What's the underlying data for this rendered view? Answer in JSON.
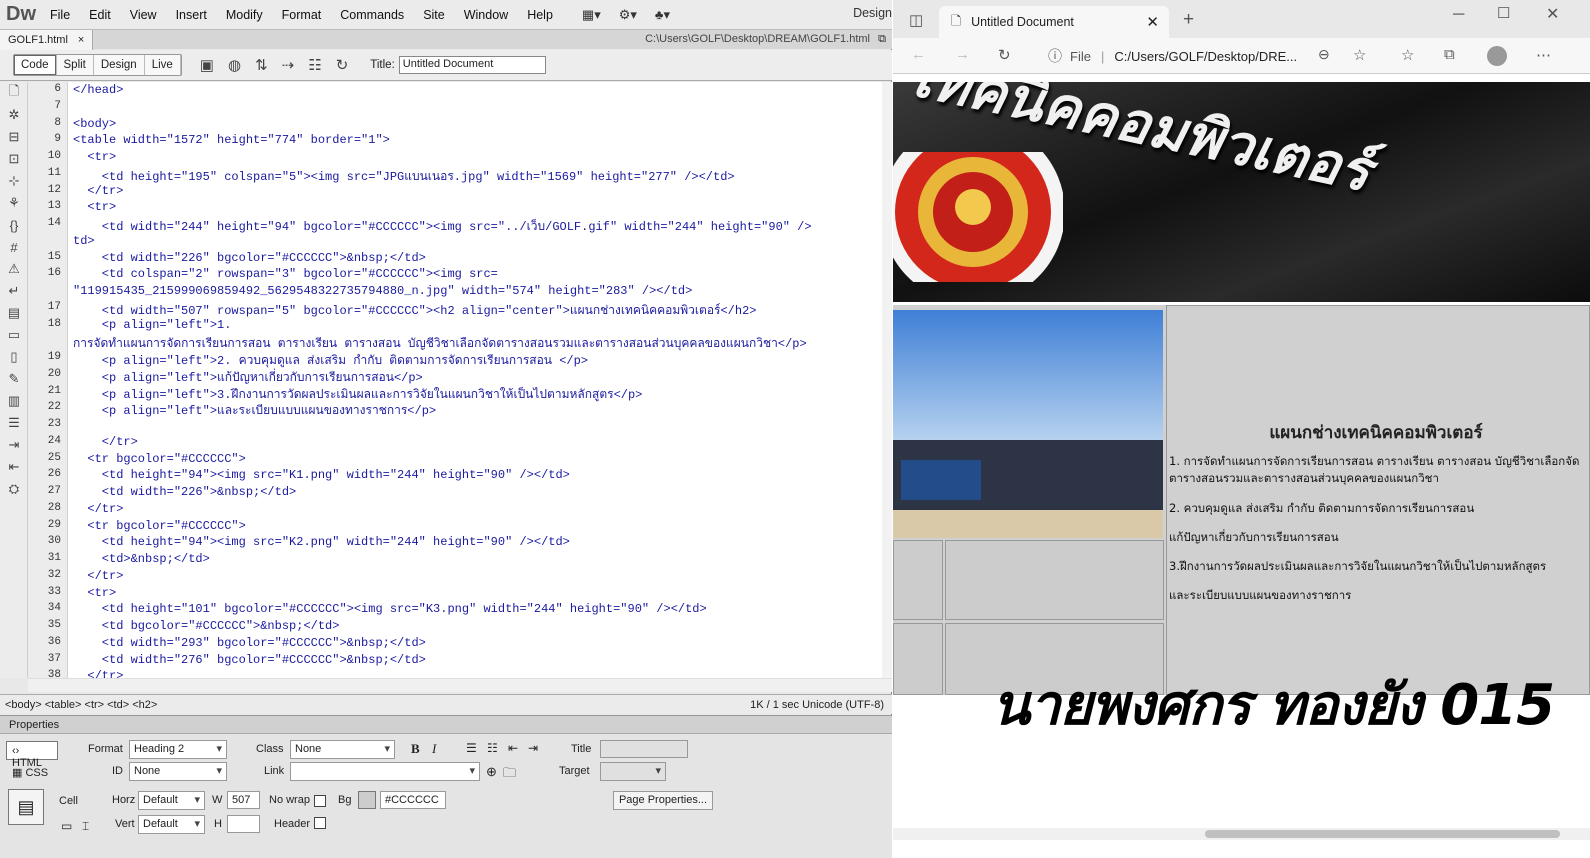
{
  "menubar": {
    "logo": "Dw",
    "items": [
      "File",
      "Edit",
      "View",
      "Insert",
      "Modify",
      "Format",
      "Commands",
      "Site",
      "Window",
      "Help"
    ],
    "workspace": "Design"
  },
  "docbar": {
    "tab": "GOLF1.html",
    "path": "C:\\Users\\GOLF\\Desktop\\DREAM\\GOLF1.html"
  },
  "toolbar": {
    "code": "Code",
    "split": "Split",
    "design": "Design",
    "live": "Live",
    "title_label": "Title:",
    "title_value": "Untitled Document"
  },
  "code": {
    "lines": [
      {
        "n": "6",
        "t": "</head>"
      },
      {
        "n": "7",
        "t": ""
      },
      {
        "n": "8",
        "t": "<body>"
      },
      {
        "n": "9",
        "t": "<table width=\"1572\" height=\"774\" border=\"1\">"
      },
      {
        "n": "10",
        "t": "  <tr>"
      },
      {
        "n": "11",
        "t": "    <td height=\"195\" colspan=\"5\"><img src=\"JPGแบนเนอร.jpg\" width=\"1569\" height=\"277\" /></td>"
      },
      {
        "n": "12",
        "t": "  </tr>"
      },
      {
        "n": "13",
        "t": "  <tr>"
      },
      {
        "n": "14",
        "t": "    <td width=\"244\" height=\"94\" bgcolor=\"#CCCCCC\"><img src=\"../เว็บ/GOLF.gif\" width=\"244\" height=\"90\" />"
      },
      {
        "n": "",
        "t": "td>"
      },
      {
        "n": "15",
        "t": "    <td width=\"226\" bgcolor=\"#CCCCCC\">&nbsp;</td>"
      },
      {
        "n": "16",
        "t": "    <td colspan=\"2\" rowspan=\"3\" bgcolor=\"#CCCCCC\"><img src="
      },
      {
        "n": "",
        "t": "\"119915435_215999069859492_5629548322735794880_n.jpg\" width=\"574\" height=\"283\" /></td>"
      },
      {
        "n": "17",
        "t": "    <td width=\"507\" rowspan=\"5\" bgcolor=\"#CCCCCC\"><h2 align=\"center\">แผนกช่างเทคนิคคอมพิวเตอร์</h2>"
      },
      {
        "n": "18",
        "t": "    <p align=\"left\">1."
      },
      {
        "n": "",
        "t": "การจัดทำแผนการจัดการเรียนการสอน ตารางเรียน ตารางสอน บัญชีวิชาเลือกจัดตารางสอนรวมและตารางสอนส่วนบุคคลของแผนกวิชา</p>"
      },
      {
        "n": "19",
        "t": "    <p align=\"left\">2. ควบคุมดูแล ส่งเสริม กำกับ ติดตามการจัดการเรียนการสอน </p>"
      },
      {
        "n": "20",
        "t": "    <p align=\"left\">แก้ปัญหาเกี่ยวกับการเรียนการสอน</p>"
      },
      {
        "n": "21",
        "t": "    <p align=\"left\">3.ฝึกงานการวัดผลประเมินผลและการวิจัยในแผนกวิชาให้เป็นไปตามหลักสูตร</p>"
      },
      {
        "n": "22",
        "t": "    <p align=\"left\">และระเบียบแบบแผนของทางราชการ</p>"
      },
      {
        "n": "23",
        "t": ""
      },
      {
        "n": "24",
        "t": "    </tr>"
      },
      {
        "n": "25",
        "t": "  <tr bgcolor=\"#CCCCCC\">"
      },
      {
        "n": "26",
        "t": "    <td height=\"94\"><img src=\"K1.png\" width=\"244\" height=\"90\" /></td>"
      },
      {
        "n": "27",
        "t": "    <td width=\"226\">&nbsp;</td>"
      },
      {
        "n": "28",
        "t": "  </tr>"
      },
      {
        "n": "29",
        "t": "  <tr bgcolor=\"#CCCCCC\">"
      },
      {
        "n": "30",
        "t": "    <td height=\"94\"><img src=\"K2.png\" width=\"244\" height=\"90\" /></td>"
      },
      {
        "n": "31",
        "t": "    <td>&nbsp;</td>"
      },
      {
        "n": "32",
        "t": "  </tr>"
      },
      {
        "n": "33",
        "t": "  <tr>"
      },
      {
        "n": "34",
        "t": "    <td height=\"101\" bgcolor=\"#CCCCCC\"><img src=\"K3.png\" width=\"244\" height=\"90\" /></td>"
      },
      {
        "n": "35",
        "t": "    <td bgcolor=\"#CCCCCC\">&nbsp;</td>"
      },
      {
        "n": "36",
        "t": "    <td width=\"293\" bgcolor=\"#CCCCCC\">&nbsp;</td>"
      },
      {
        "n": "37",
        "t": "    <td width=\"276\" bgcolor=\"#CCCCCC\">&nbsp;</td>"
      },
      {
        "n": "38",
        "t": "  </tr>"
      }
    ]
  },
  "status": {
    "tags": "<body> <table> <tr> <td> <h2>",
    "info": "1K / 1 sec  Unicode (UTF-8)"
  },
  "props": {
    "header": "Properties",
    "html": "HTML",
    "css": "CSS",
    "format_label": "Format",
    "format_value": "Heading 2",
    "class_label": "Class",
    "class_value": "None",
    "id_label": "ID",
    "id_value": "None",
    "link_label": "Link",
    "title_label": "Title",
    "target_label": "Target",
    "cell": "Cell",
    "horz_label": "Horz",
    "horz_value": "Default",
    "vert_label": "Vert",
    "vert_value": "Default",
    "w_label": "W",
    "w_value": "507",
    "h_label": "H",
    "nowrap": "No wrap",
    "header_lbl": "Header",
    "bg_label": "Bg",
    "bg_value": "#CCCCCC",
    "page_props": "Page Properties..."
  },
  "browser": {
    "tab_title": "Untitled Document",
    "file_label": "File",
    "address": "C:/Users/GOLF/Desktop/DRE..."
  },
  "page": {
    "banner_text": "เทคนิคคอมพิวเตอร์",
    "heading": "แผนกช่างเทคนิคคอมพิวเตอร์",
    "p1": "1. การจัดทำแผนการจัดการเรียนการสอน ตารางเรียน ตารางสอน บัญชีวิชาเลือกจัดตารางสอนรวมและตารางสอนส่วนบุคคลของแผนกวิชา",
    "p2": "2. ควบคุมดูแล ส่งเสริม กำกับ ติดตามการจัดการเรียนการสอน",
    "p3": "แก้ปัญหาเกี่ยวกับการเรียนการสอน",
    "p4": "3.ฝึกงานการวัดผลประเมินผลและการวิจัยในแผนกวิชาให้เป็นไปตามหลักสูตร",
    "p5": "และระเบียบแบบแผนของทางราชการ",
    "signature": "นายพงศกร ทองยัง 015"
  }
}
